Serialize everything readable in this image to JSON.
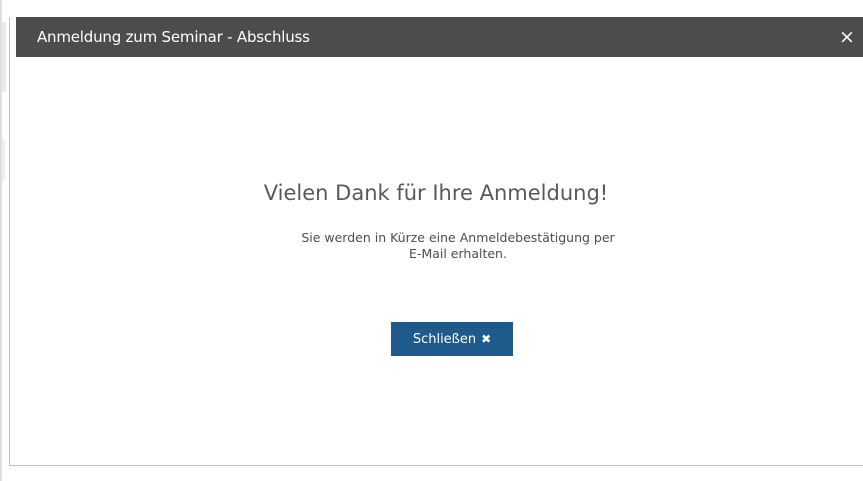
{
  "dialog": {
    "title": "Anmeldung zum Seminar - Abschluss",
    "close_glyph": "×",
    "heading": "Vielen Dank für Ihre Anmeldung!",
    "message_line1": "Sie werden in Kürze eine Anmeldebestätigung per",
    "message_line2": "E-Mail erhalten.",
    "button_label": "Schließen",
    "button_icon": "close-icon",
    "button_icon_glyph": "✖"
  },
  "colors": {
    "titlebar": "#4c4c4c",
    "button": "#1f5a8c",
    "heading_text": "#595959"
  }
}
